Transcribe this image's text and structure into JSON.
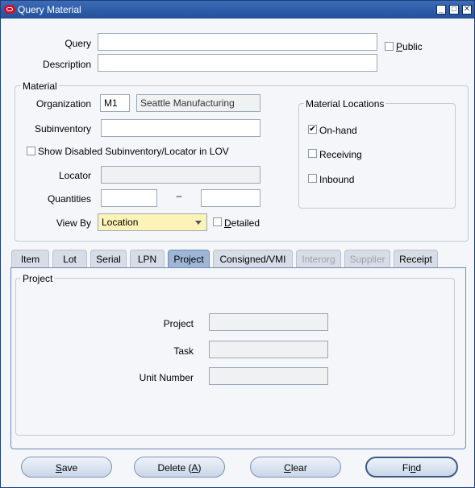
{
  "window": {
    "title": "Query Material",
    "controls": [
      "minimize-icon",
      "maximize-icon",
      "close-icon"
    ]
  },
  "query": {
    "label": "Query",
    "value": "",
    "public_label": "Public",
    "public_checked": false,
    "description_label": "Description",
    "description_value": ""
  },
  "material": {
    "group_title": "Material",
    "organization_label": "Organization",
    "organization_code": "M1",
    "organization_name": "Seattle Manufacturing",
    "subinventory_label": "Subinventory",
    "subinventory_value": "",
    "show_disabled_label": "Show Disabled Subinventory/Locator in LOV",
    "show_disabled_checked": false,
    "locator_label": "Locator",
    "locator_value": "",
    "quantities_label": "Quantities",
    "quantity_from": "",
    "quantity_dash": "–",
    "quantity_to": "",
    "view_by_label": "View By",
    "view_by_value": "Location",
    "detailed_label": "Detailed",
    "detailed_checked": false
  },
  "locations": {
    "group_title": "Material Locations",
    "items": [
      {
        "label": "On-hand",
        "checked": true
      },
      {
        "label": "Receiving",
        "checked": false
      },
      {
        "label": "Inbound",
        "checked": false
      }
    ]
  },
  "tabs": [
    {
      "label": "Item",
      "state": "normal"
    },
    {
      "label": "Lot",
      "state": "normal"
    },
    {
      "label": "Serial",
      "state": "normal"
    },
    {
      "label": "LPN",
      "state": "normal"
    },
    {
      "label": "Project",
      "state": "active"
    },
    {
      "label": "Consigned/VMI",
      "state": "normal"
    },
    {
      "label": "Interorg",
      "state": "disabled"
    },
    {
      "label": "Supplier",
      "state": "disabled"
    },
    {
      "label": "Receipt",
      "state": "normal"
    }
  ],
  "project_panel": {
    "group_title": "Project",
    "project_label": "Project",
    "project_value": "",
    "task_label": "Task",
    "task_value": "",
    "unit_number_label": "Unit Number",
    "unit_number_value": ""
  },
  "buttons": {
    "save": "Save",
    "delete": "Delete (A)",
    "clear": "Clear",
    "find": "Find"
  },
  "colors": {
    "titlebar": "#24509b",
    "view_by_field": "#fdf2b8",
    "active_tab": "#9db6d6"
  }
}
